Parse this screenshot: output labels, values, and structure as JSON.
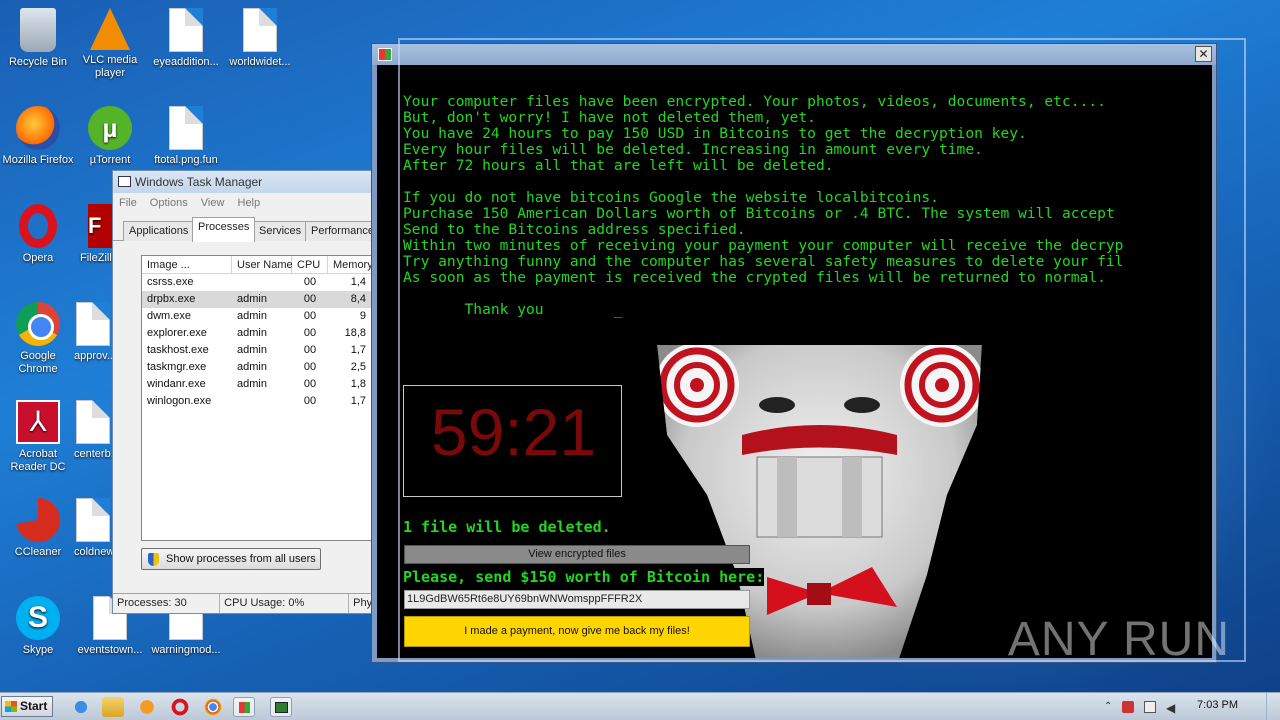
{
  "desktop": {
    "icons": [
      {
        "label": "Recycle Bin",
        "icon": "recycle-bin-icon"
      },
      {
        "label": "VLC media player",
        "icon": "vlc-icon"
      },
      {
        "label": "eyeaddition...",
        "icon": "document-icon"
      },
      {
        "label": "worldwidet...",
        "icon": "document-icon"
      },
      {
        "label": "Mozilla Firefox",
        "icon": "firefox-icon"
      },
      {
        "label": "µTorrent",
        "icon": "utorrent-icon"
      },
      {
        "label": "ftotal.png.fun",
        "icon": "document-icon"
      },
      {
        "label": "Opera",
        "icon": "opera-icon"
      },
      {
        "label": "FileZilla",
        "icon": "filezilla-icon"
      },
      {
        "label": "Google Chrome",
        "icon": "chrome-icon"
      },
      {
        "label": "approv...",
        "icon": "document-icon"
      },
      {
        "label": "Acrobat Reader DC",
        "icon": "acrobat-icon"
      },
      {
        "label": "centerb...",
        "icon": "document-icon"
      },
      {
        "label": "CCleaner",
        "icon": "ccleaner-icon"
      },
      {
        "label": "coldnew...",
        "icon": "document-icon"
      },
      {
        "label": "Skype",
        "icon": "skype-icon"
      },
      {
        "label": "eventstown...",
        "icon": "document-icon"
      },
      {
        "label": "warningmod...",
        "icon": "document-icon"
      }
    ]
  },
  "task_manager": {
    "title": "Windows Task Manager",
    "menu": [
      "File",
      "Options",
      "View",
      "Help"
    ],
    "tabs": [
      "Applications",
      "Processes",
      "Services",
      "Performance"
    ],
    "active_tab": "Processes",
    "columns": [
      "Image ...",
      "User Name",
      "CPU",
      "Memory"
    ],
    "rows": [
      {
        "image": "csrss.exe",
        "user": "",
        "cpu": "00",
        "mem": "1,4"
      },
      {
        "image": "drpbx.exe",
        "user": "admin",
        "cpu": "00",
        "mem": "8,4"
      },
      {
        "image": "dwm.exe",
        "user": "admin",
        "cpu": "00",
        "mem": "9"
      },
      {
        "image": "explorer.exe",
        "user": "admin",
        "cpu": "00",
        "mem": "18,8"
      },
      {
        "image": "taskhost.exe",
        "user": "admin",
        "cpu": "00",
        "mem": "1,7"
      },
      {
        "image": "taskmgr.exe",
        "user": "admin",
        "cpu": "00",
        "mem": "2,5"
      },
      {
        "image": "windanr.exe",
        "user": "admin",
        "cpu": "00",
        "mem": "1,8"
      },
      {
        "image": "winlogon.exe",
        "user": "",
        "cpu": "00",
        "mem": "1,7"
      }
    ],
    "show_all_button": "Show processes from all users",
    "status": {
      "processes": "Processes: 30",
      "cpu": "CPU Usage: 0%",
      "phys": "Phy"
    }
  },
  "ransom": {
    "message": "Your computer files have been encrypted. Your photos, videos, documents, etc....\nBut, don't worry! I have not deleted them, yet.\nYou have 24 hours to pay 150 USD in Bitcoins to get the decryption key.\nEvery hour files will be deleted. Increasing in amount every time.\nAfter 72 hours all that are left will be deleted.\n\nIf you do not have bitcoins Google the website localbitcoins.\nPurchase 150 American Dollars worth of Bitcoins or .4 BTC. The system will accept\nSend to the Bitcoins address specified.\nWithin two minutes of receiving your payment your computer will receive the decryp\nTry anything funny and the computer has several safety measures to delete your fil\nAs soon as the payment is received the crypted files will be returned to normal.\n\n       Thank you        _",
    "timer": "59:21",
    "deleted_notice": "1 file will be deleted.",
    "view_button": "View encrypted files",
    "send_label": "Please, send $150 worth of Bitcoin here:",
    "bitcoin_address": "1L9GdBW65Rt6e8UY69bnWNWomsppFFFR2X",
    "pay_button": "I made a payment, now give me back my files!",
    "close_glyph": "✕"
  },
  "watermark": "ANY RUN",
  "taskbar": {
    "start_label": "Start",
    "clock": "7:03 PM",
    "apps": [
      "ie-icon",
      "explorer-icon",
      "media-player-icon",
      "opera-icon",
      "chrome-icon",
      "ransom-app-icon",
      "task-manager-icon"
    ]
  }
}
